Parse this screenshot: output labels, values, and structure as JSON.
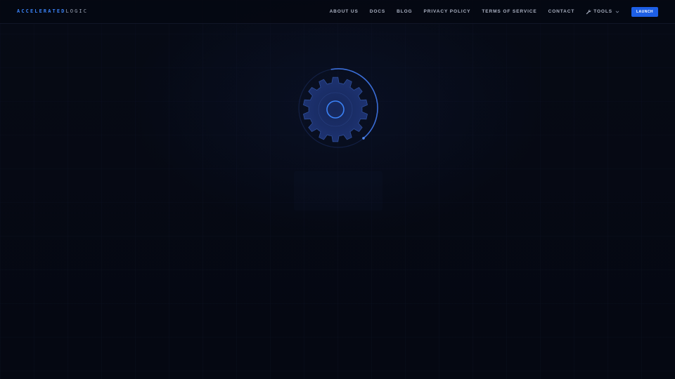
{
  "brand": {
    "part_a": "ACCELERATED",
    "part_b": "LOGIC",
    "accent_color": "#3b82f6"
  },
  "nav": {
    "links": [
      {
        "label": "ABOUT US"
      },
      {
        "label": "DOCS"
      },
      {
        "label": "BLOG"
      },
      {
        "label": "PRIVACY POLICY"
      },
      {
        "label": "TERMS OF SERVICE"
      },
      {
        "label": "CONTACT"
      }
    ],
    "tools": {
      "label": "TOOLS",
      "icon": "wrench-icon",
      "caret_icon": "chevron-down-icon"
    },
    "launch_label": "LAUNCH"
  },
  "loader": {
    "icon": "gear-icon",
    "state": "loading"
  },
  "colors": {
    "background": "#060a15",
    "primary": "#1d5fe6",
    "gear_fill": "#1b2c63",
    "gear_ring": "#3b82f6",
    "nav_text": "#aab1c2"
  }
}
